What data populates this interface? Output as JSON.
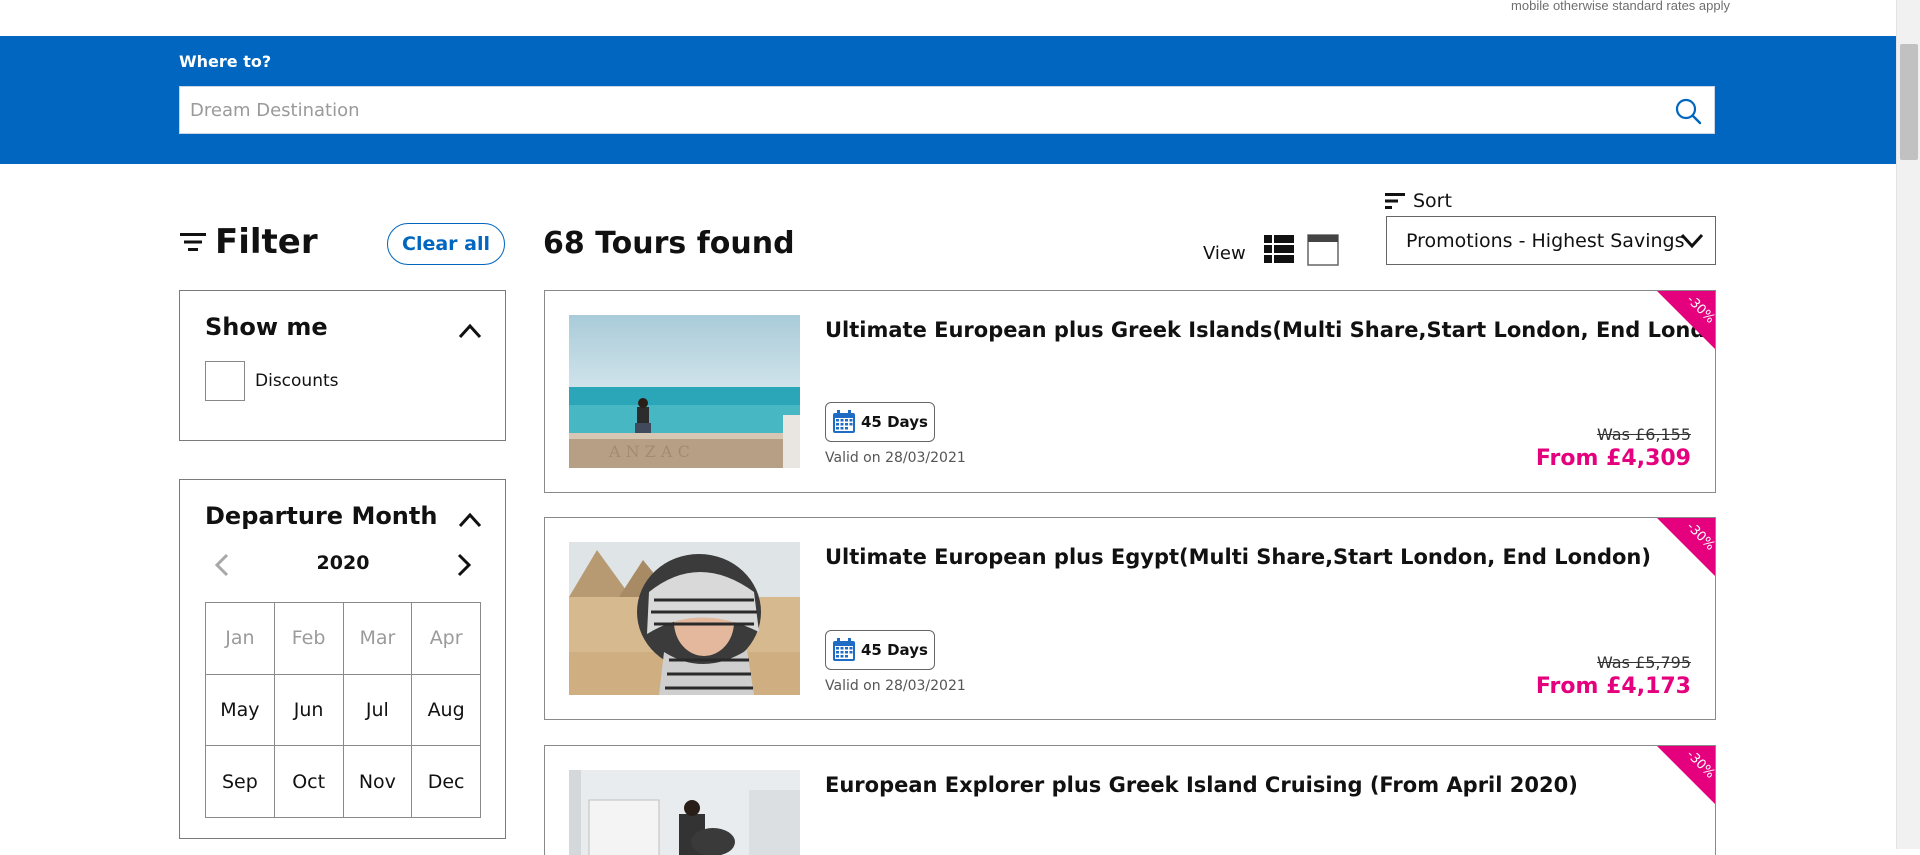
{
  "top_notice": "mobile otherwise standard rates apply",
  "search": {
    "label": "Where to?",
    "placeholder": "Dream Destination",
    "value": ""
  },
  "filter": {
    "title": "Filter",
    "clear_label": "Clear all",
    "show_me": {
      "title": "Show me",
      "option_label": "Discounts",
      "checked": false
    },
    "departure": {
      "title": "Departure Month",
      "year": "2020",
      "months": [
        {
          "label": "Jan",
          "enabled": false
        },
        {
          "label": "Feb",
          "enabled": false
        },
        {
          "label": "Mar",
          "enabled": false
        },
        {
          "label": "Apr",
          "enabled": false
        },
        {
          "label": "May",
          "enabled": true
        },
        {
          "label": "Jun",
          "enabled": true
        },
        {
          "label": "Jul",
          "enabled": true
        },
        {
          "label": "Aug",
          "enabled": true
        },
        {
          "label": "Sep",
          "enabled": true
        },
        {
          "label": "Oct",
          "enabled": true
        },
        {
          "label": "Nov",
          "enabled": true
        },
        {
          "label": "Dec",
          "enabled": true
        }
      ]
    }
  },
  "results": {
    "count_label": "68 Tours found",
    "view_label": "View",
    "sort_label": "Sort",
    "sort_value": "Promotions - Highest Savings"
  },
  "tours": [
    {
      "title": "Ultimate European plus Greek Islands(Multi Share,Start London, End London)",
      "days": "45 Days",
      "valid": "Valid on 28/03/2021",
      "was": "Was £6,155",
      "from": "From £4,309",
      "discount": "-30%"
    },
    {
      "title": "Ultimate European plus Egypt(Multi Share,Start London, End London)",
      "days": "45 Days",
      "valid": "Valid on 28/03/2021",
      "was": "Was £5,795",
      "from": "From £4,173",
      "discount": "-30%"
    },
    {
      "title": "European Explorer plus Greek Island Cruising (From April 2020)",
      "discount": "-30%"
    }
  ],
  "colors": {
    "brand_blue": "#0066c0",
    "price_pink": "#e5007e",
    "ribbon_pink": "#e5007e"
  },
  "icons": {
    "search": "search-icon",
    "filter": "filter-lines-icon",
    "sort": "sort-lines-icon",
    "list_view": "list-view-icon",
    "grid_view": "card-view-icon",
    "calendar": "calendar-icon"
  }
}
